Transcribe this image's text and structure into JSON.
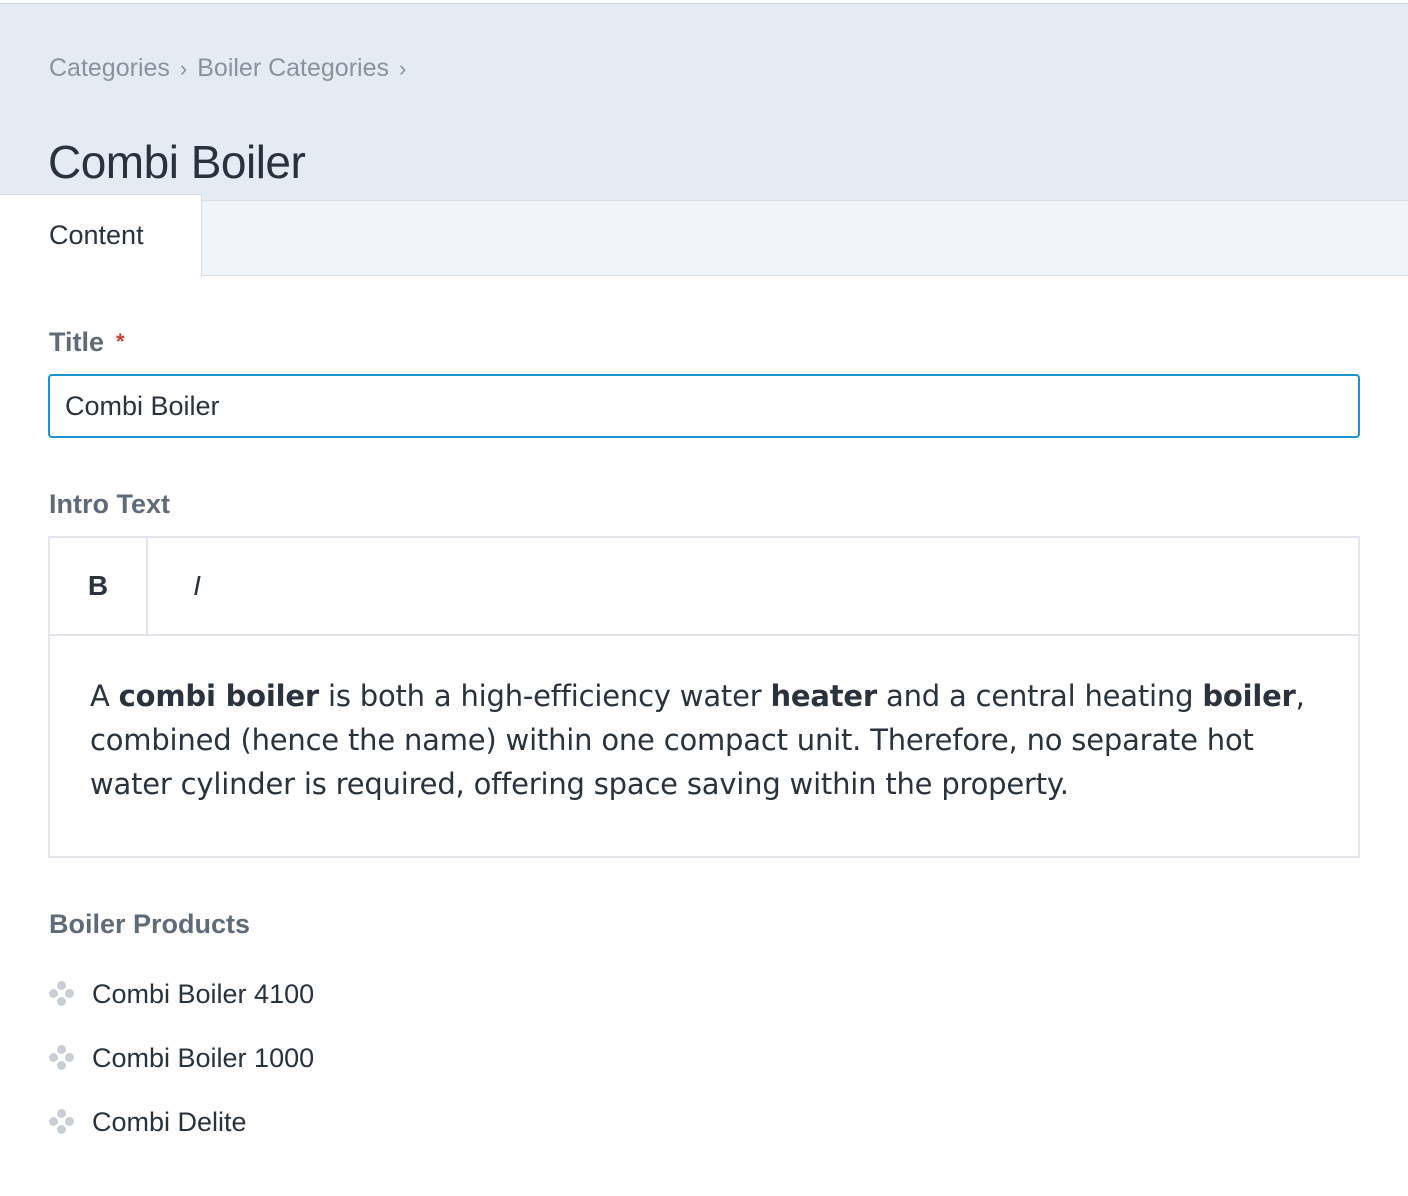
{
  "breadcrumb": [
    "Categories",
    "Boiler Categories"
  ],
  "breadcrumb_separator": "›",
  "page_title": "Combi Boiler",
  "tabs": [
    {
      "label": "Content",
      "active": true
    }
  ],
  "fields": {
    "title": {
      "label": "Title",
      "required_marker": "*",
      "value": "Combi Boiler"
    },
    "intro": {
      "label": "Intro Text",
      "toolbar": {
        "bold_label": "B",
        "italic_label": "I"
      },
      "paragraph": [
        {
          "text": "A ",
          "bold": false
        },
        {
          "text": "combi boiler",
          "bold": true
        },
        {
          "text": " is both a high-efficiency water ",
          "bold": false
        },
        {
          "text": "heater",
          "bold": true
        },
        {
          "text": " and a central heating ",
          "bold": false
        },
        {
          "text": "boiler",
          "bold": true
        },
        {
          "text": ", combined (hence the name) within one compact unit. Therefore, no separate hot water cylinder is required, offering space saving within the property.",
          "bold": false
        }
      ]
    },
    "products": {
      "label": "Boiler Products",
      "items": [
        {
          "label": "Combi Boiler 4100",
          "icon": "drag-handle-icon"
        },
        {
          "label": "Combi Boiler 1000",
          "icon": "drag-handle-icon"
        },
        {
          "label": "Combi Delite",
          "icon": "drag-handle-icon"
        }
      ]
    }
  },
  "colors": {
    "header_bg": "#e4ebf3",
    "focus_border": "#1a94d4",
    "required": "#cf3a3a",
    "label": "#5f6b78"
  }
}
